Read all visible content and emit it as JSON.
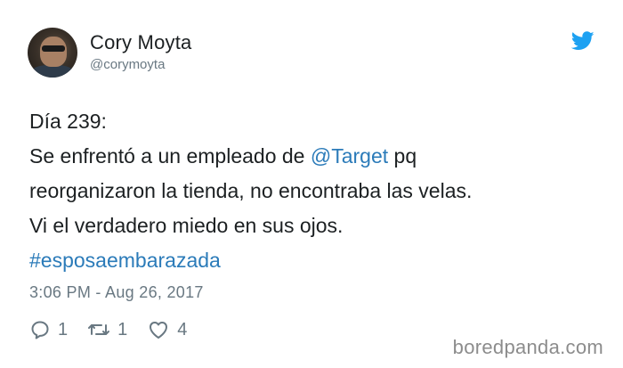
{
  "author": {
    "display_name": "Cory Moyta",
    "handle": "@corymoyta",
    "avatar_icon": "user-photo-avatar"
  },
  "brand_icon": "twitter-bird-icon",
  "colors": {
    "link": "#2b7bb9",
    "bird": "#1da1f2",
    "muted": "#697882",
    "text": "#1c2022"
  },
  "tweet": {
    "line1": "Día 239:",
    "line2_prefix": "Se enfrentó a un empleado de ",
    "line2_mention": "@Target",
    "line2_suffix": " pq",
    "line3": "reorganizaron la tienda, no encontraba las velas.",
    "line4": "Vi el verdadero miedo en sus ojos.",
    "hashtag": "#esposaembarazada"
  },
  "timestamp": "3:06 PM - Aug 26, 2017",
  "actions": {
    "replies": "1",
    "retweets": "1",
    "likes": "4"
  },
  "watermark": "boredpanda.com"
}
